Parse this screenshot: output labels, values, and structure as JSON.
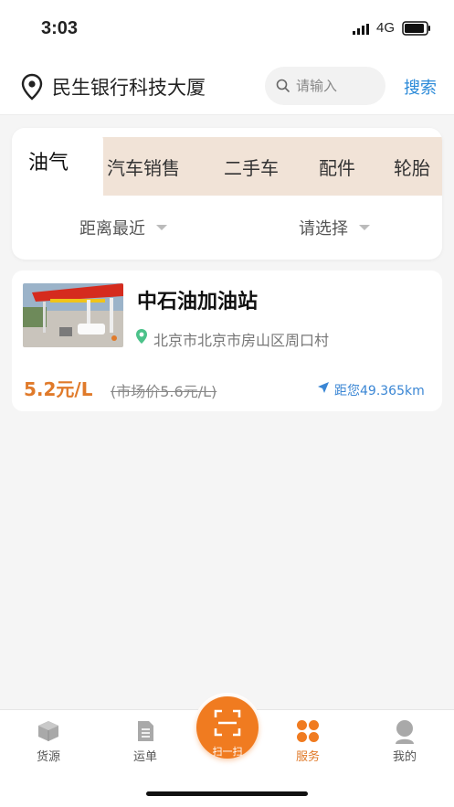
{
  "status_bar": {
    "time": "3:03",
    "network": "4G"
  },
  "header": {
    "location": "民生银行科技大厦",
    "search_placeholder": "请输入",
    "search_button": "搜索"
  },
  "tabs": [
    "油气",
    "汽车销售",
    "二手车",
    "配件",
    "轮胎"
  ],
  "filters": {
    "distance": "距离最近",
    "select": "请选择"
  },
  "station": {
    "name": "中石油加油站",
    "address": "北京市北京市房山区周口村",
    "price": "5.2元/L",
    "market_price": "(市场价5.6元/L)",
    "distance": "距您49.365km"
  },
  "bottom_nav": {
    "cargo": "货源",
    "waybill": "运单",
    "scan": "扫一扫",
    "service": "服务",
    "mine": "我的"
  },
  "colors": {
    "accent": "#f07b20",
    "link": "#2b8ad8",
    "tab_bg": "#f1e3d7"
  }
}
